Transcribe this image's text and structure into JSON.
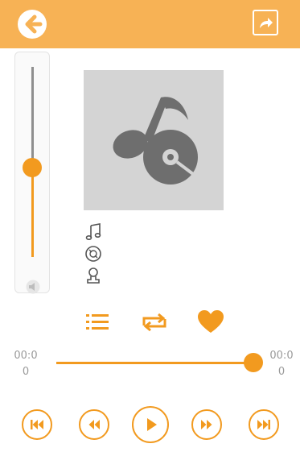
{
  "header": {
    "back_icon": "back-arrow-icon",
    "share_icon": "share-icon",
    "bar_color": "#f7b255"
  },
  "volume": {
    "level": 0.47,
    "mute_icon": "speaker-muted-icon"
  },
  "album_art": {
    "icon": "music-disc-icon",
    "background": "#d4d4d4"
  },
  "track_meta": {
    "icons": [
      "music-note-icon",
      "album-disc-icon",
      "artist-icon"
    ]
  },
  "actions": {
    "icons": [
      "playlist-icon",
      "repeat-icon",
      "favorite-heart-icon"
    ],
    "accent": "#f29a1f"
  },
  "progress": {
    "elapsed_line1": "00:0",
    "elapsed_line2": "0",
    "total_line1": "00:0",
    "total_line2": "0",
    "fraction": 1.0
  },
  "controls": {
    "icons": [
      "skip-previous-icon",
      "rewind-icon",
      "play-icon",
      "fast-forward-icon",
      "skip-next-icon"
    ]
  }
}
